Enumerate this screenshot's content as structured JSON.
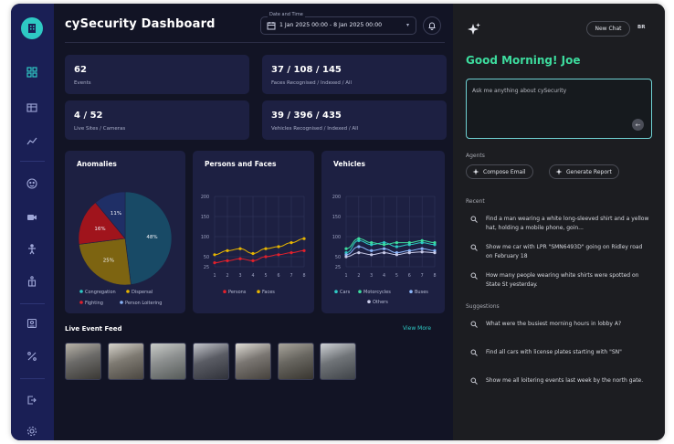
{
  "app": {
    "title": "cySecurity Dashboard",
    "accent": "#2ec9c4",
    "greeting_color": "#3ddc9e"
  },
  "sidebar": {
    "icons": [
      "logo-icon",
      "dashboard-icon",
      "table-icon",
      "trend-icon",
      "face-icon",
      "camera-icon",
      "person-icon",
      "building-icon",
      "id-card-icon",
      "percent-icon",
      "logout-icon",
      "settings-icon"
    ]
  },
  "header": {
    "date_label": "Date and Time",
    "date_value": "1 Jan 2025 00:00 - 8 Jan 2025 00:00"
  },
  "stats": [
    {
      "value": "62",
      "label": "Events"
    },
    {
      "value": "37 / 108 / 145",
      "label": "Faces Recognised / Indexed / All"
    },
    {
      "value": "4 / 52",
      "label": "Live Sites / Cameras"
    },
    {
      "value": "39 / 396 / 435",
      "label": "Vehicles Recognised / Indexed / All"
    }
  ],
  "anomalies": {
    "title": "Anomalies",
    "chart_data": {
      "type": "pie",
      "labels": [
        "Congregation",
        "Dispersal",
        "Fighting",
        "Person Loitering"
      ],
      "values": [
        48,
        25,
        16,
        11
      ],
      "label_text": [
        "48%",
        "25%",
        "16%",
        "11%"
      ],
      "colors": [
        "#184a66",
        "#7d6411",
        "#a0141c",
        "#1f2f66"
      ],
      "legend_colors": [
        "#2ec9c4",
        "#e6b400",
        "#e0202c",
        "#8ab4f8"
      ],
      "legend": "bottom"
    }
  },
  "persons": {
    "title": "Persons and Faces",
    "chart_data": {
      "type": "line",
      "x": [
        1,
        2,
        3,
        4,
        5,
        6,
        7,
        8
      ],
      "ylim": [
        25,
        200
      ],
      "yticks": [
        25,
        50,
        100,
        150,
        200
      ],
      "series": [
        {
          "name": "Persons",
          "color": "#e0202c",
          "values": [
            35,
            40,
            45,
            40,
            50,
            55,
            60,
            65
          ]
        },
        {
          "name": "Faces",
          "color": "#e6b400",
          "values": [
            55,
            65,
            70,
            58,
            70,
            75,
            85,
            95
          ]
        }
      ],
      "grid": true,
      "legend": "bottom"
    }
  },
  "vehicles": {
    "title": "Vehicles",
    "chart_data": {
      "type": "line",
      "x": [
        1,
        2,
        3,
        4,
        5,
        6,
        7,
        8
      ],
      "ylim": [
        25,
        200
      ],
      "yticks": [
        25,
        50,
        100,
        150,
        200
      ],
      "series": [
        {
          "name": "Cars",
          "color": "#2ec9c4",
          "values": [
            60,
            90,
            80,
            85,
            75,
            80,
            85,
            80
          ]
        },
        {
          "name": "Motorcycles",
          "color": "#3ddc9e",
          "values": [
            70,
            95,
            85,
            80,
            85,
            85,
            90,
            85
          ]
        },
        {
          "name": "Buses",
          "color": "#8ab4f8",
          "values": [
            55,
            75,
            65,
            70,
            60,
            65,
            70,
            65
          ]
        },
        {
          "name": "Others",
          "color": "#c9cbe8",
          "values": [
            50,
            60,
            55,
            60,
            55,
            60,
            62,
            60
          ]
        }
      ],
      "grid": true,
      "legend": "bottom"
    }
  },
  "feed": {
    "title": "Live Event Feed",
    "view_more": "View More",
    "thumb_count": 7
  },
  "assistant": {
    "new_chat": "New Chat",
    "avatar": "BR",
    "greeting": "Good Morning! Joe",
    "placeholder": "Ask me anything about cySecurity",
    "agents_label": "Agents",
    "agents": [
      "Compose Email",
      "Generate Report"
    ],
    "recent_label": "Recent",
    "recent": [
      "Find a man wearing a white long-sleeved shirt and a yellow hat, holding a mobile phone, goin...",
      "Show me car with LPR \"SMN6493D\" going on Ridley road on February 18",
      "How many people wearing white shirts were spotted on State St yesterday."
    ],
    "suggestions_label": "Suggestions",
    "suggestions": [
      "What were the busiest morning hours in lobby A?",
      "Find all cars with license plates starting with \"SN\"",
      "Show me all loitering events last week by the north gate."
    ]
  }
}
